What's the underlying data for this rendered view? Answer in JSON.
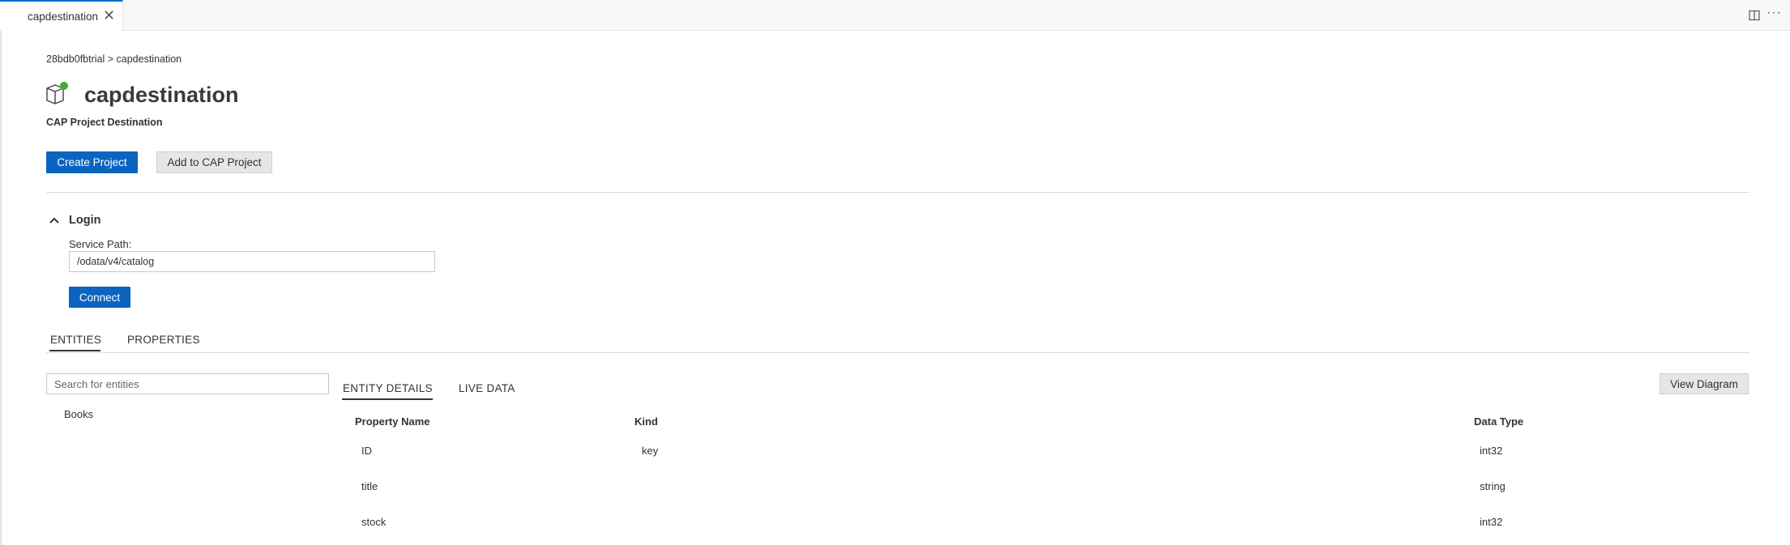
{
  "tabbar": {
    "tab_label": "capdestination",
    "close_glyph": "✕",
    "more_glyph": "···"
  },
  "breadcrumb": "28bdb0fbtrial > capdestination",
  "header": {
    "title": "capdestination",
    "subtitle": "CAP Project Destination",
    "icon": "package-icon",
    "status_color": "#3fae32"
  },
  "actions": {
    "create_label": "Create Project",
    "add_label": "Add to CAP Project"
  },
  "login": {
    "title": "Login",
    "service_path_label": "Service Path:",
    "service_path_value": "/odata/v4/catalog",
    "connect_label": "Connect"
  },
  "main_tabs": [
    {
      "label": "ENTITIES",
      "active": true
    },
    {
      "label": "PROPERTIES",
      "active": false
    }
  ],
  "entities": {
    "search_placeholder": "Search for entities",
    "items": [
      "Books"
    ]
  },
  "sub_tabs": [
    {
      "label": "ENTITY DETAILS",
      "active": true
    },
    {
      "label": "LIVE DATA",
      "active": false
    }
  ],
  "view_diagram_label": "View Diagram",
  "table": {
    "headers": [
      "Property Name",
      "Kind",
      "Data Type"
    ],
    "rows": [
      [
        "ID",
        "key",
        "int32"
      ],
      [
        "title",
        "",
        "string"
      ],
      [
        "stock",
        "",
        "int32"
      ]
    ]
  },
  "colors": {
    "accent": "#0b64c0"
  }
}
